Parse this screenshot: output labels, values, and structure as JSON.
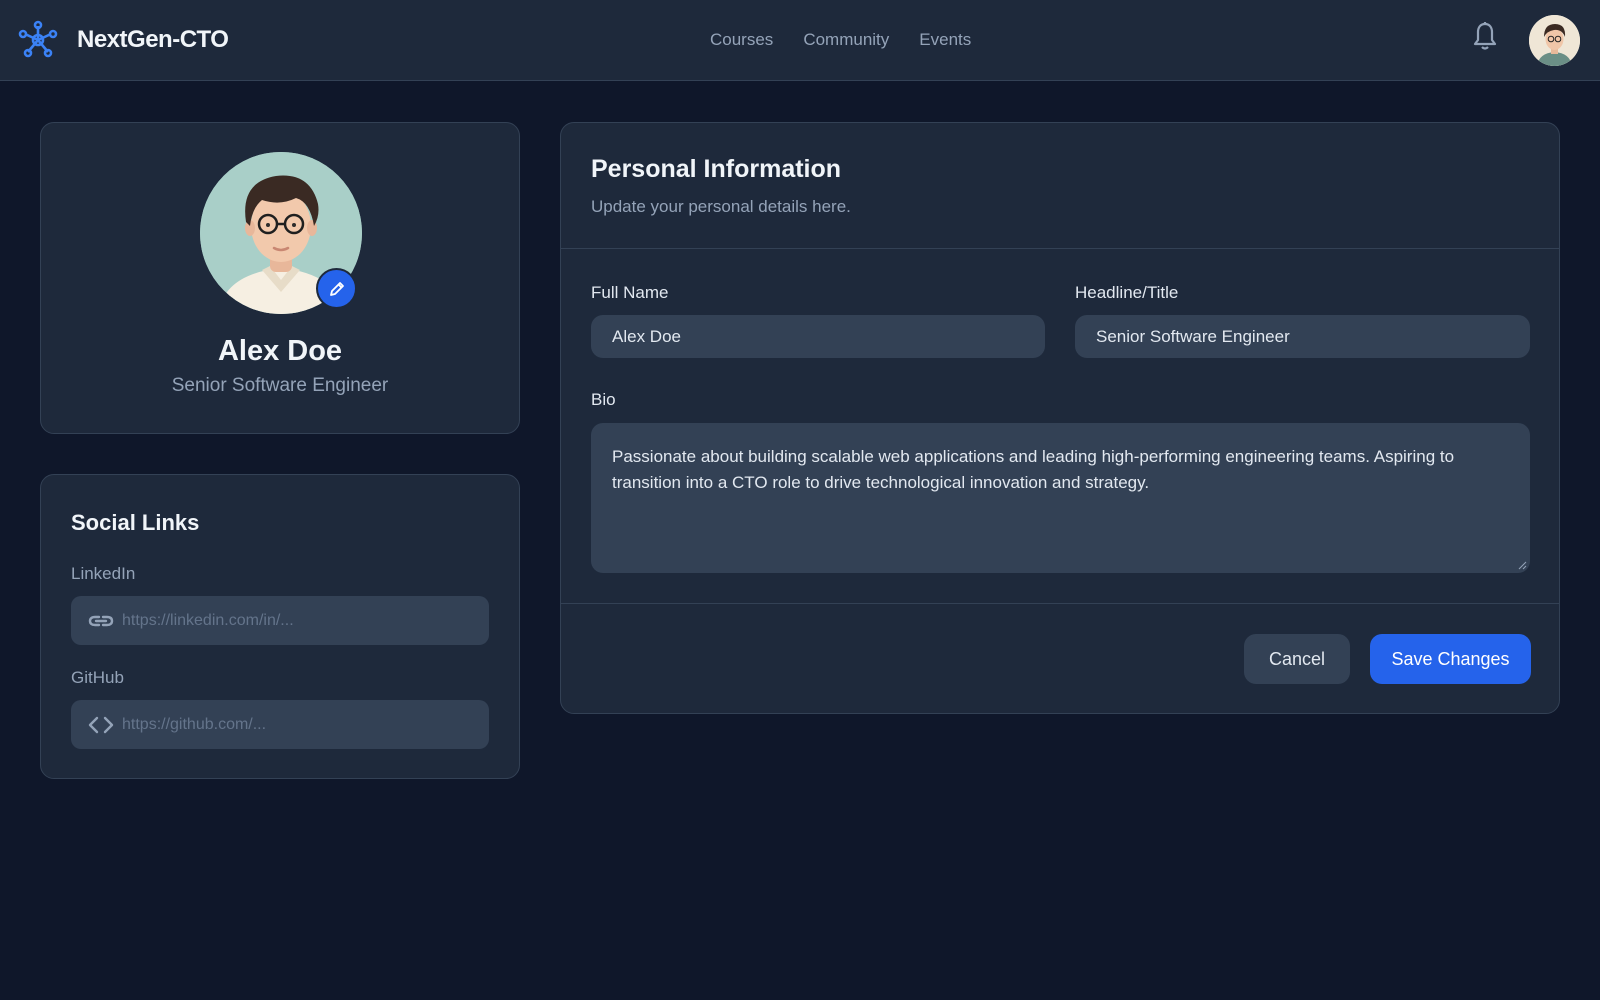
{
  "header": {
    "brand": "NextGen-CTO",
    "nav": [
      "Courses",
      "Community",
      "Events"
    ]
  },
  "profile": {
    "name": "Alex Doe",
    "title": "Senior Software Engineer"
  },
  "social": {
    "heading": "Social Links",
    "linkedin_label": "LinkedIn",
    "linkedin_placeholder": "https://linkedin.com/in/...",
    "github_label": "GitHub",
    "github_placeholder": "https://github.com/..."
  },
  "personal": {
    "heading": "Personal Information",
    "subheading": "Update your personal details here.",
    "full_name_label": "Full Name",
    "full_name_value": "Alex Doe",
    "headline_label": "Headline/Title",
    "headline_value": "Senior Software Engineer",
    "bio_label": "Bio",
    "bio_value": "Passionate about building scalable web applications and leading high-performing engineering teams. Aspiring to transition into a CTO role to drive technological innovation and strategy.",
    "cancel_label": "Cancel",
    "save_label": "Save Changes"
  },
  "icons": {
    "logo": "network-logo-icon",
    "notifications": "bell-icon",
    "edit_avatar": "pencil-icon",
    "linkedin_field": "link-icon",
    "github_field": "code-icon"
  },
  "colors": {
    "background": "#0f172a",
    "surface": "#1e293b",
    "input": "#334155",
    "accent": "#2563eb",
    "muted_text": "#94a3b8"
  }
}
